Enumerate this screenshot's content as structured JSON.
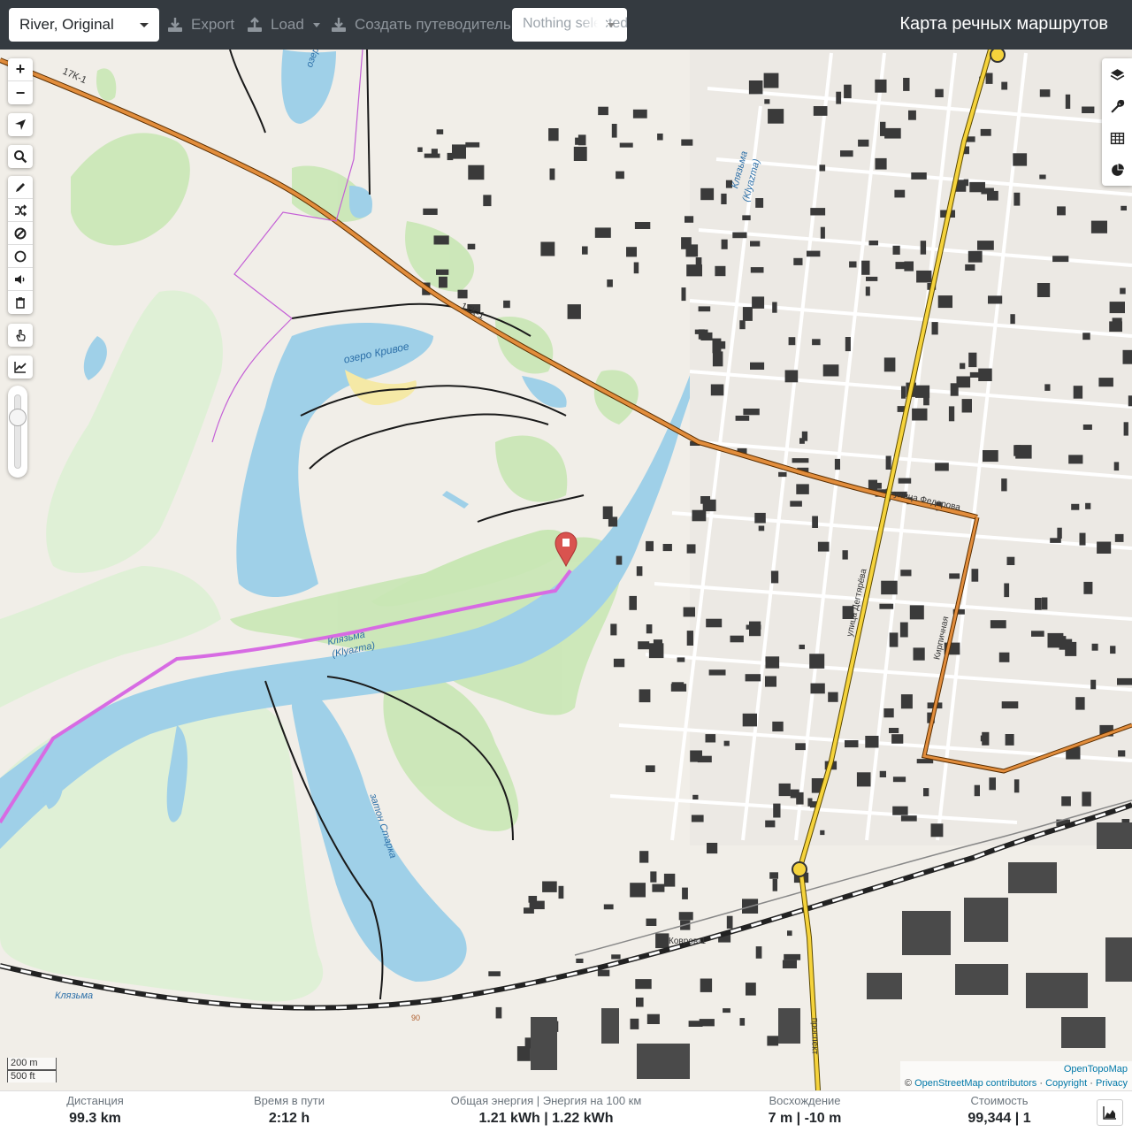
{
  "navbar": {
    "profile_value": "River, Original",
    "export_label": "Export",
    "load_label": "Load",
    "guide_label": "Создать путеводитель",
    "selection_value": "Nothing selected",
    "title": "Карта речных маршрутов"
  },
  "map": {
    "zoom_in": "+",
    "zoom_out": "−",
    "labels": {
      "road_17k1": "17К-1",
      "road_17k1_b": "17К-1",
      "lake_krivoe": "озеро Кривое",
      "klyazma_north": "Клязьма",
      "klyazma_north_en": "(Klyazma)",
      "klyazma_mid": "Клязьма",
      "klyazma_mid_en": "(Klyazma)",
      "zaton": "затон Старка",
      "klyazma_sw": "Клязьма",
      "street_fedorova": "улица Федорова",
      "street_dekt": "улица Дегтярёва",
      "street_kir": "Кирпичная",
      "station": "Ковров-1",
      "prospekt": "проспект",
      "contour_90": "90",
      "ozero_north": "озеро"
    },
    "scale_m": "200 m",
    "scale_ft": "500 ft",
    "attribution": {
      "line1": "OpenTopoMap",
      "prefix": "©",
      "osm": "OpenStreetMap contributors",
      "sep": "·",
      "copyright": "Copyright",
      "privacy": "Privacy"
    },
    "colors": {
      "water": "#aad3df",
      "river": "#9fd0e8",
      "forest": "#c7e6b4",
      "meadow": "#dcf0cf",
      "road_major": "#e28d3c",
      "road_yellow": "#f5d33c",
      "route": "#d76be3",
      "building": "#3a3a3a",
      "marker": "#d9534f"
    },
    "icons": [
      "layers-icon",
      "wrench-icon",
      "table-icon",
      "pie-chart-icon"
    ]
  },
  "stats": {
    "distance": {
      "label": "Дистанция",
      "value": "99.3 km"
    },
    "time": {
      "label": "Время в пути",
      "value": "2:12 h"
    },
    "energy": {
      "label": "Общая энергия | Энергия на 100 км",
      "value": "1.21 kWh | 1.22 kWh"
    },
    "ascent": {
      "label": "Восхождение",
      "value": "7 m | -10 m"
    },
    "cost": {
      "label": "Стоимость",
      "value": "99,344 | 1"
    }
  }
}
